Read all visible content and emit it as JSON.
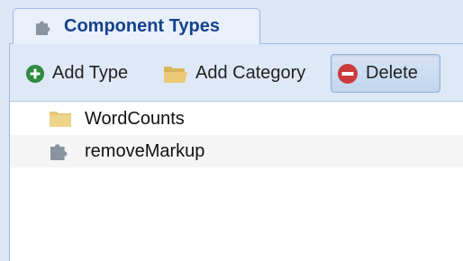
{
  "tab": {
    "title": "Component Types",
    "icon": "puzzle-icon"
  },
  "toolbar": {
    "add_type_label": "Add Type",
    "add_category_label": "Add Category",
    "delete_label": "Delete"
  },
  "tree": {
    "items": [
      {
        "label": "WordCounts",
        "icon": "folder-icon"
      },
      {
        "label": "removeMarkup",
        "icon": "puzzle-icon"
      }
    ]
  },
  "colors": {
    "header_text": "#15428b",
    "add_green": "#2e8b3e",
    "delete_red": "#cc3b3b",
    "folder": "#e8c776",
    "border": "#99bbe8"
  }
}
